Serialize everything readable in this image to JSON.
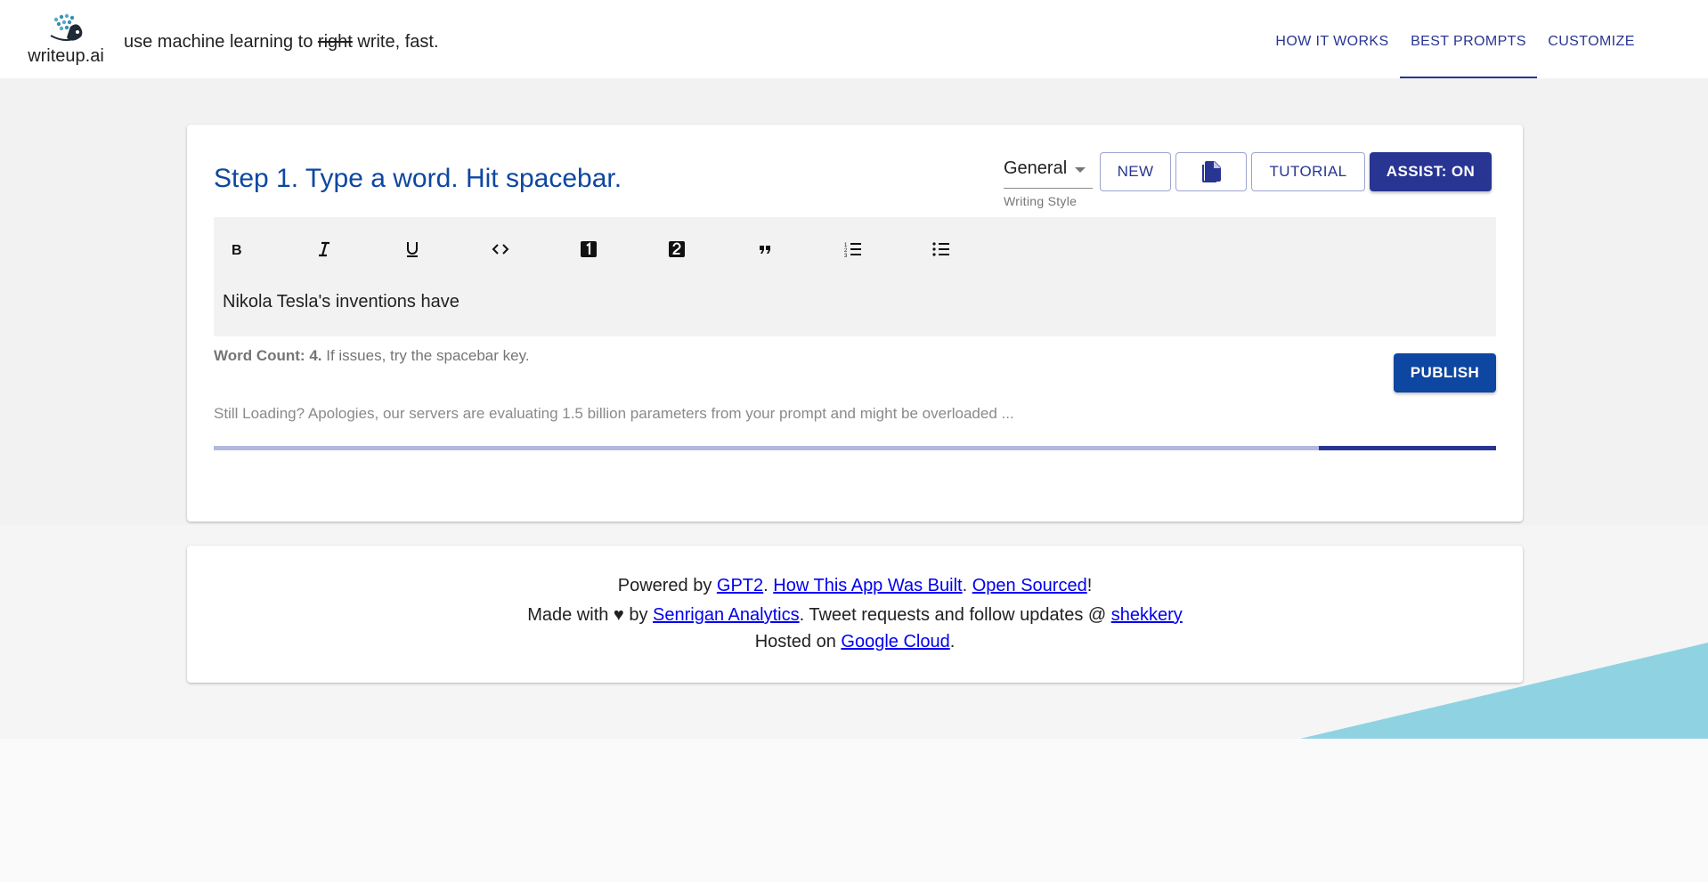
{
  "header": {
    "logo_text": "writeup.ai",
    "tagline_before": "use machine learning to ",
    "tagline_strike": "right",
    "tagline_after": " write, fast.",
    "nav": [
      {
        "label": "HOW IT WORKS",
        "active": false
      },
      {
        "label": "BEST PROMPTS",
        "active": true
      },
      {
        "label": "CUSTOMIZE",
        "active": false
      }
    ]
  },
  "editor": {
    "title": "Step 1. Type a word. Hit spacebar.",
    "writing_style": {
      "value": "General",
      "helper": "Writing Style"
    },
    "buttons": {
      "new": "NEW",
      "copy_icon": "copy-file-icon",
      "tutorial": "TUTORIAL",
      "assist": "ASSIST: ON"
    },
    "toolbar": [
      {
        "icon": "bold-icon",
        "glyph": "B"
      },
      {
        "icon": "italic-icon",
        "glyph": "I"
      },
      {
        "icon": "underline-icon",
        "glyph": "U"
      },
      {
        "icon": "code-icon",
        "glyph": "<>"
      },
      {
        "icon": "heading-one-icon",
        "glyph": "1"
      },
      {
        "icon": "heading-two-icon",
        "glyph": "2"
      },
      {
        "icon": "quote-icon",
        "glyph": "”"
      },
      {
        "icon": "numbered-list-icon",
        "glyph": "ol"
      },
      {
        "icon": "bulleted-list-icon",
        "glyph": "ul"
      }
    ],
    "content": "Nikola Tesla's inventions have",
    "word_count_label": "Word Count: 4.",
    "word_count_hint": " If issues, try the spacebar key.",
    "publish": "PUBLISH",
    "loading_message": "Still Loading? Apologies, our servers are evaluating 1.5 billion parameters from your prompt and might be overloaded ...",
    "progress": {
      "start_fraction": 0.862,
      "end_fraction": 1.0
    }
  },
  "footer": {
    "line1": {
      "prefix": "Powered by ",
      "link1": "GPT2",
      "sep1": ". ",
      "link2": "How This App Was Built",
      "sep2": ". ",
      "link3": "Open Sourced",
      "suffix": "!"
    },
    "line2": {
      "prefix": "Made with ♥ by ",
      "link1": "Senrigan Analytics",
      "middle": ". Tweet requests and follow updates @ ",
      "link2": "shekkery"
    },
    "line3": {
      "prefix": "Hosted on ",
      "link1": "Google Cloud",
      "suffix": "."
    }
  },
  "colors": {
    "primary": "#283593",
    "title_blue": "#0d47a1",
    "progress_track": "#b3b8e0",
    "triangle": "#8fd3e3"
  }
}
